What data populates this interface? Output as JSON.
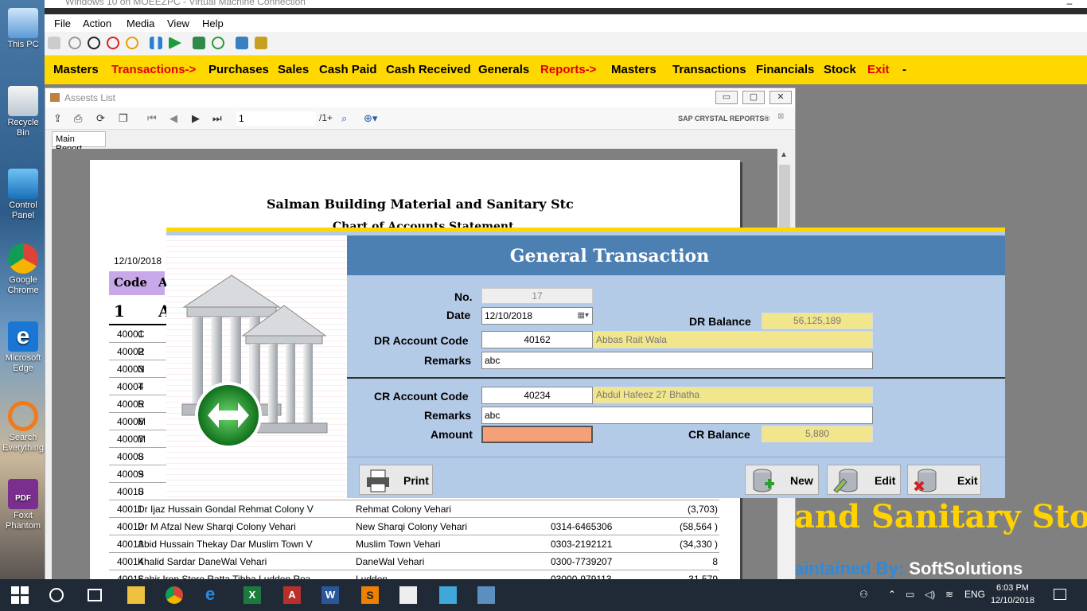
{
  "vm": {
    "title": "Windows 10 on MOEEZPC - Virtual Machine Connection",
    "menu": [
      "File",
      "Action",
      "Media",
      "View",
      "Help"
    ]
  },
  "desktop_icons": [
    {
      "label": "This PC",
      "icon": "this-pc-icon"
    },
    {
      "label": "Recycle Bin",
      "icon": "recycle-bin-icon"
    },
    {
      "label": "Control Panel",
      "icon": "control-panel-icon"
    },
    {
      "label": "Google Chrome",
      "icon": "chrome-icon"
    },
    {
      "label": "Microsoft Edge",
      "icon": "edge-icon"
    },
    {
      "label": "Search Everything",
      "icon": "search-everything-icon"
    },
    {
      "label": "Foxit Phantom",
      "icon": "foxit-pdf-icon"
    }
  ],
  "app_menu": [
    {
      "label": "Masters",
      "color": "#000000"
    },
    {
      "label": "Transactions->",
      "color": "#e00000"
    },
    {
      "label": "Purchases",
      "color": "#000000"
    },
    {
      "label": "Sales",
      "color": "#000000"
    },
    {
      "label": "Cash Paid",
      "color": "#000000"
    },
    {
      "label": "Cash Received",
      "color": "#000000"
    },
    {
      "label": "Generals",
      "color": "#000000"
    },
    {
      "label": "Reports->",
      "color": "#e00000"
    },
    {
      "label": "Masters",
      "color": "#000000"
    },
    {
      "label": "Transactions",
      "color": "#000000"
    },
    {
      "label": "Financials",
      "color": "#000000"
    },
    {
      "label": "Stock",
      "color": "#000000"
    },
    {
      "label": "Exit",
      "color": "#e00000"
    },
    {
      "label": "-",
      "color": "#000000"
    }
  ],
  "background": {
    "store_title": "and Sanitary Store",
    "maintained_prefix": "aintained By:",
    "maintained_by": "SoftSolutions"
  },
  "assets_window": {
    "title": "Assests List",
    "page_value": "1",
    "page_total": "/1+",
    "brand": "SAP CRYSTAL REPORTS®",
    "tab": "Main Report",
    "report": {
      "title": "Salman Building Material and Sanitary Stc",
      "subtitle": "Chart of Accounts Statement",
      "date": "12/10/2018",
      "header_code": "Code",
      "header_a": "A",
      "group_number": "1",
      "group_a": "A",
      "rows": [
        {
          "code": "40001",
          "name": "C",
          "addr": "",
          "phone": "",
          "bal": ""
        },
        {
          "code": "40002",
          "name": "R",
          "addr": "",
          "phone": "",
          "bal": ""
        },
        {
          "code": "40003",
          "name": "N",
          "addr": "",
          "phone": "",
          "bal": ""
        },
        {
          "code": "40004",
          "name": "T",
          "addr": "",
          "phone": "",
          "bal": ""
        },
        {
          "code": "40005",
          "name": "R",
          "addr": "",
          "phone": "",
          "bal": ""
        },
        {
          "code": "40006",
          "name": "M",
          "addr": "",
          "phone": "",
          "bal": ""
        },
        {
          "code": "40007",
          "name": "M",
          "addr": "",
          "phone": "",
          "bal": ""
        },
        {
          "code": "40008",
          "name": "S",
          "addr": "",
          "phone": "",
          "bal": ""
        },
        {
          "code": "40009",
          "name": "S",
          "addr": "",
          "phone": "",
          "bal": ""
        },
        {
          "code": "40010",
          "name": "S",
          "addr": "",
          "phone": "",
          "bal": ""
        },
        {
          "code": "40011",
          "name": "Dr Ijaz Hussain Gondal Rehmat Colony V",
          "addr": "Rehmat Colony Vehari",
          "phone": "",
          "bal": "(3,703)"
        },
        {
          "code": "40012",
          "name": "Dr M Afzal New Sharqi Colony Vehari",
          "addr": "New Sharqi Colony Vehari",
          "phone": "0314-6465306",
          "bal": "(58,564 )"
        },
        {
          "code": "40013",
          "name": "Abid Hussain Thekay Dar Muslim Town V",
          "addr": "Muslim Town Vehari",
          "phone": "0303-2192121",
          "bal": "(34,330 )"
        },
        {
          "code": "40014",
          "name": "Khalid Sardar DaneWal Vehari",
          "addr": "DaneWal Vehari",
          "phone": "0300-7739207",
          "bal": "8"
        },
        {
          "code": "40015",
          "name": "Sabir Iron Store Ratta Tibba Ludden Roa",
          "addr": "Ludden",
          "phone": "03000-979113",
          "bal": "31,579"
        }
      ]
    }
  },
  "dialog": {
    "title": "General Transaction",
    "no_label": "No.",
    "no_value": "17",
    "date_label": "Date",
    "date_value": "12/10/2018",
    "dr_balance_label": "DR Balance",
    "dr_balance_value": "56,125,189",
    "dr_code_label": "DR Account Code",
    "dr_code_value": "40162",
    "dr_account_name": "Abbas Rait Wala",
    "dr_remarks_label": "Remarks",
    "dr_remarks_value": "abc",
    "cr_code_label": "CR Account Code",
    "cr_code_value": "40234",
    "cr_account_name": "Abdul Hafeez 27 Bhatha",
    "cr_remarks_label": "Remarks",
    "cr_remarks_value": "abc",
    "amount_label": "Amount",
    "amount_value": "",
    "cr_balance_label": "CR Balance",
    "cr_balance_value": "5,880",
    "buttons": {
      "print": "Print",
      "new": "New",
      "edit": "Edit",
      "exit": "Exit"
    }
  },
  "taskbar": {
    "lang": "ENG",
    "time": "6:03 PM",
    "date": "12/10/2018"
  }
}
